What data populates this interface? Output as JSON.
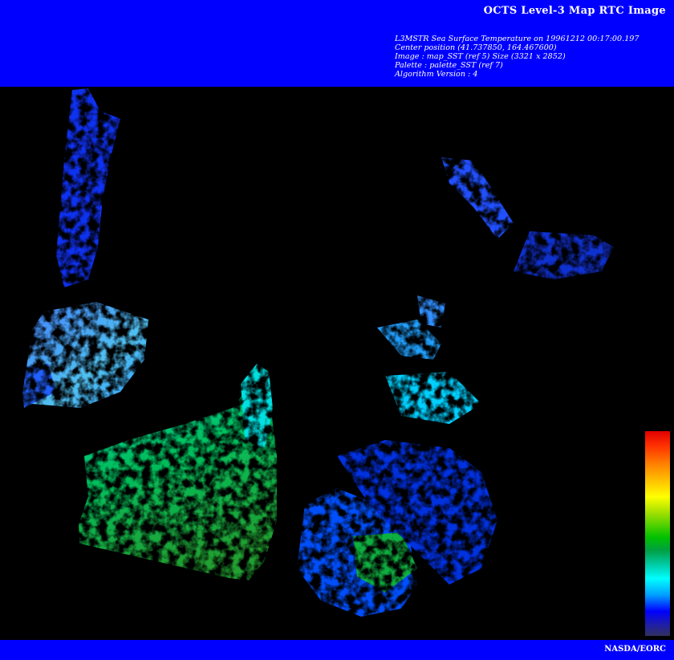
{
  "header": {
    "title": "OCTS Level-3 Map RTC Image",
    "meta_lines": [
      "L3MSTR Sea Surface Temperature on 19961212 00:17:00.197",
      "Center position (41.737850, 164.467600)",
      "Image : map_SST (ref 5) Size (3321 x 2852)",
      "Palette : palette_SST (ref 7)",
      "Algorithm Version : 4"
    ]
  },
  "image": {
    "description_icon": "satellite-sst-map",
    "palette_colors": [
      "#e00000",
      "#ff8000",
      "#ffff00",
      "#00c000",
      "#00ffff",
      "#0000ff",
      "#303060"
    ]
  },
  "footer": {
    "credit": "NASDA/EORC"
  },
  "colors": {
    "banner": "#0000ff",
    "background": "#000000",
    "text": "#ffffff"
  }
}
